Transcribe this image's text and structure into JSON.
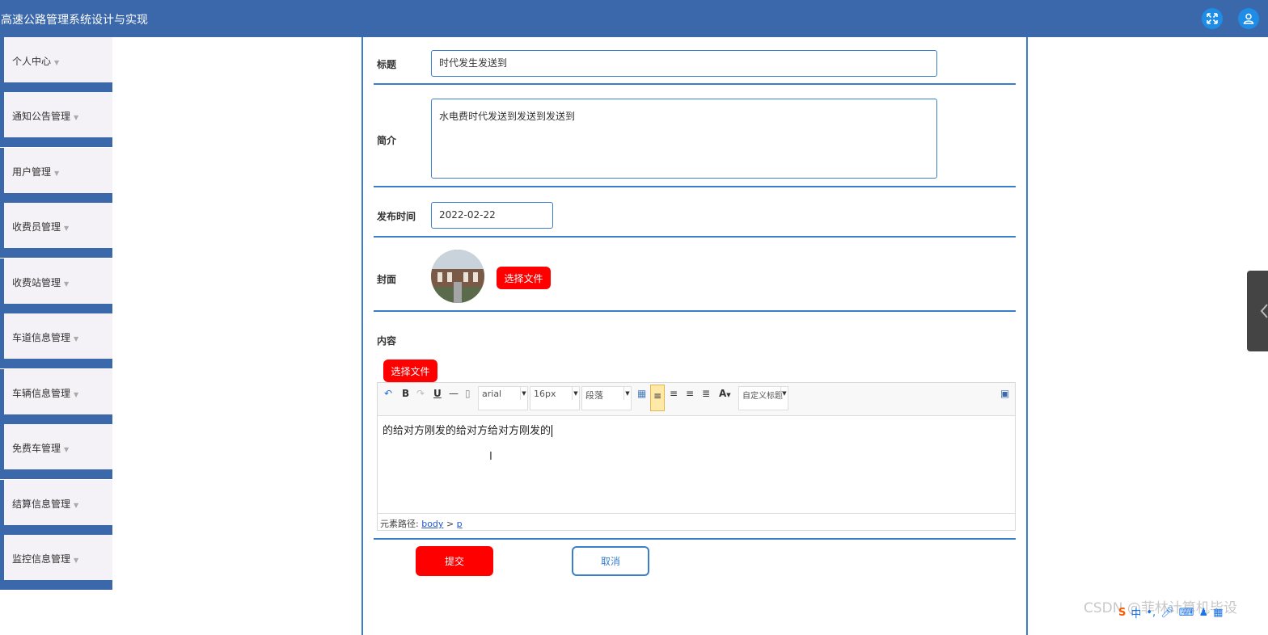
{
  "app": {
    "title": "高速公路管理系统设计与实现"
  },
  "header": {
    "fullscreen_icon": "fullscreen-icon",
    "user_icon": "user-icon"
  },
  "sidebar": {
    "items": [
      {
        "label": "个人中心"
      },
      {
        "label": "通知公告管理"
      },
      {
        "label": "用户管理"
      },
      {
        "label": "收费员管理"
      },
      {
        "label": "收费站管理"
      },
      {
        "label": "车道信息管理"
      },
      {
        "label": "车辆信息管理"
      },
      {
        "label": "免费车管理"
      },
      {
        "label": "结算信息管理"
      },
      {
        "label": "监控信息管理"
      }
    ]
  },
  "form": {
    "title_label": "标题",
    "title_value": "时代发生发送到",
    "intro_label": "简介",
    "intro_value": "水电费时代发送到发送到发送到",
    "date_label": "发布时间",
    "date_value": "2022-02-22",
    "cover_label": "封面",
    "cover_button": "选择文件",
    "content_label": "内容",
    "content_button": "选择文件",
    "submit": "提交",
    "cancel": "取消"
  },
  "editor": {
    "font_family": "arial",
    "font_size": "16px",
    "paragraph": "段落",
    "custom_title": "自定义标题",
    "body_text": "的给对方刚发的给对方给对方刚发的",
    "path_label": "元素路径:",
    "path_body": "body",
    "path_sep": ">",
    "path_p": "p"
  },
  "watermark": "CSDN @菲林计算机毕设",
  "colors": {
    "header": "#3a68aa",
    "accent": "#3a7fc8",
    "danger": "#ff0000",
    "sidebar_bg": "#f4f2f6"
  }
}
